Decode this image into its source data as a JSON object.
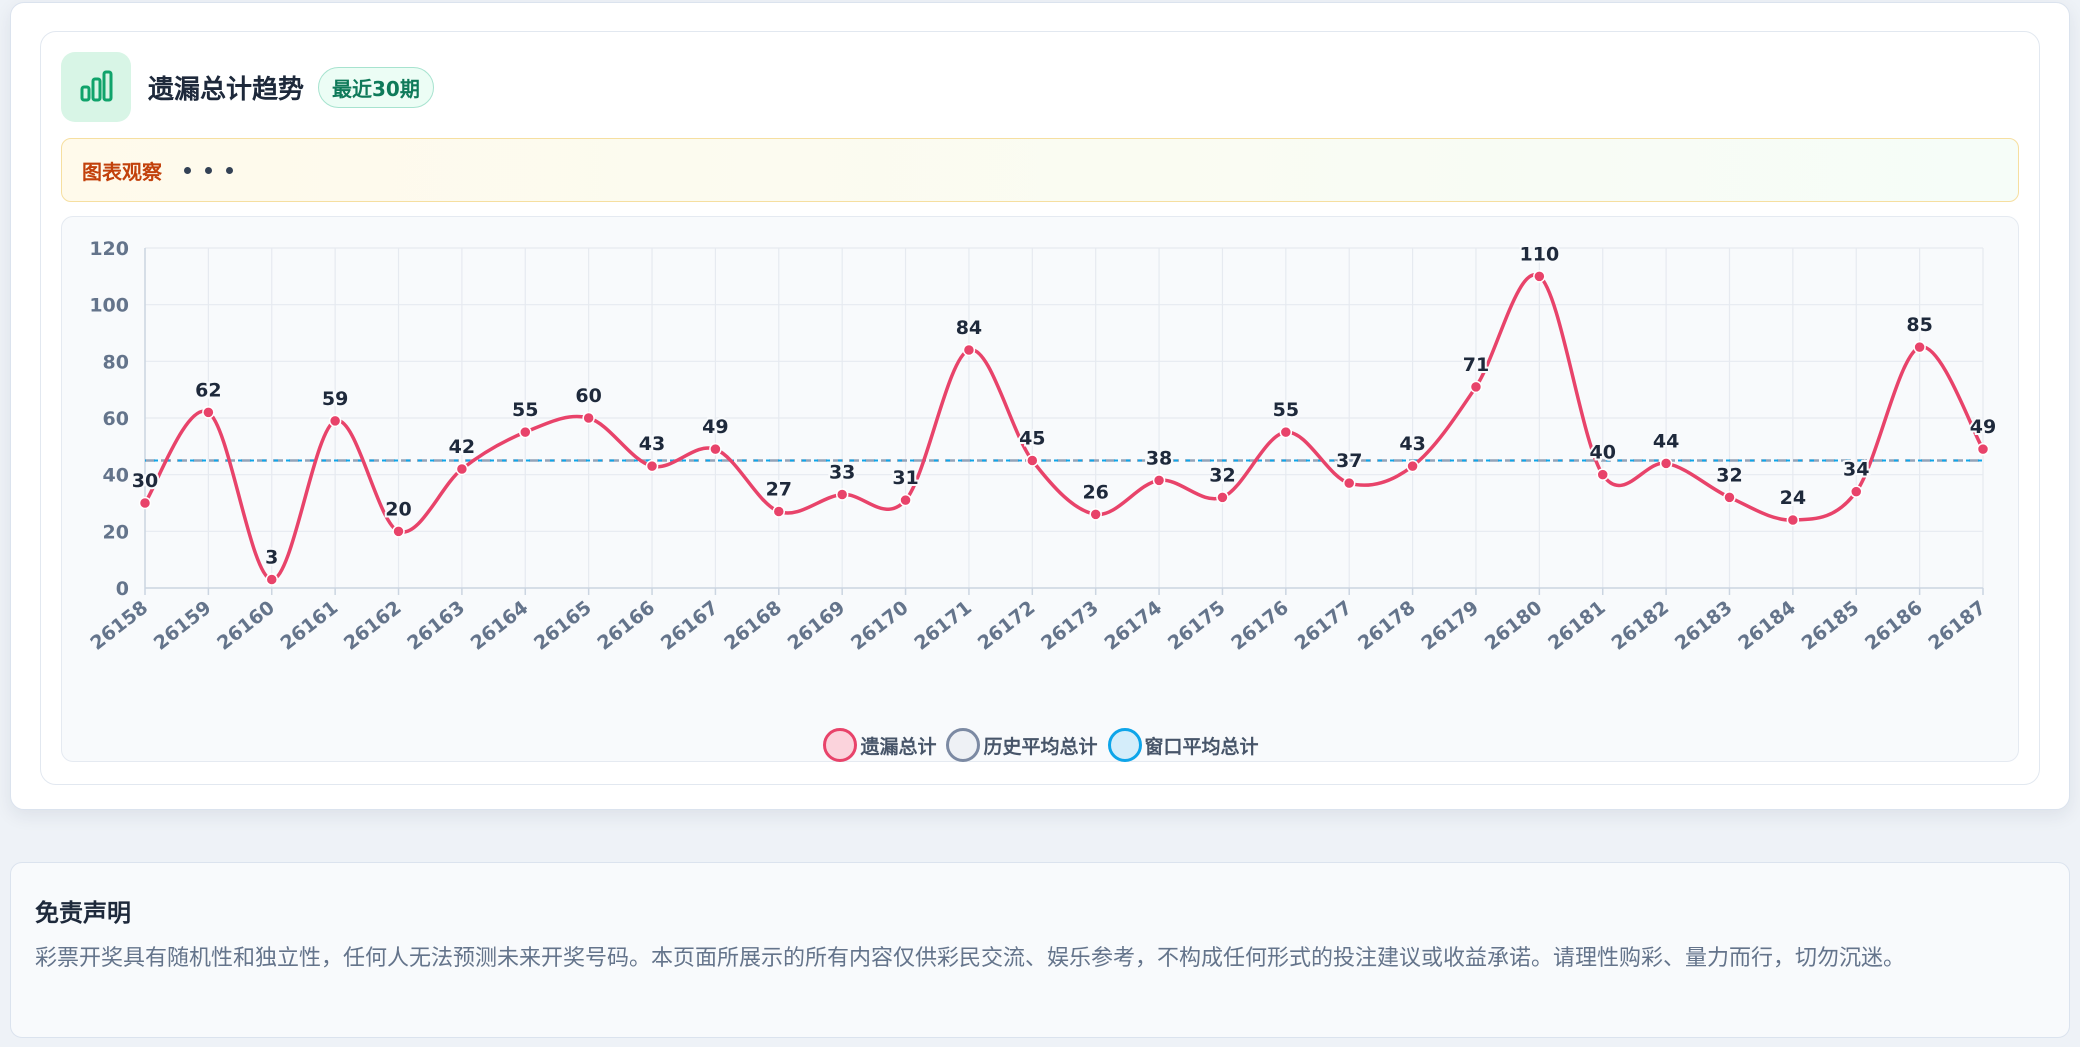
{
  "header": {
    "title": "遗漏总计趋势",
    "badge": "最近30期",
    "icon": "bar-chart-icon"
  },
  "observation": {
    "label": "图表观察"
  },
  "colors": {
    "line": "#e8436a",
    "history_avg": "#94a3b8",
    "window_avg": "#0ea5e9",
    "accent": "#10b981"
  },
  "chart_data": {
    "type": "line",
    "x": [
      "26158",
      "26159",
      "26160",
      "26161",
      "26162",
      "26163",
      "26164",
      "26165",
      "26166",
      "26167",
      "26168",
      "26169",
      "26170",
      "26171",
      "26172",
      "26173",
      "26174",
      "26175",
      "26176",
      "26177",
      "26178",
      "26179",
      "26180",
      "26181",
      "26182",
      "26183",
      "26184",
      "26185",
      "26186",
      "26187"
    ],
    "series": [
      {
        "name": "遗漏总计",
        "values": [
          30,
          62,
          3,
          59,
          20,
          42,
          55,
          60,
          43,
          49,
          27,
          33,
          31,
          84,
          45,
          26,
          38,
          32,
          55,
          37,
          43,
          71,
          110,
          40,
          44,
          32,
          24,
          34,
          85,
          49
        ]
      },
      {
        "name": "历史平均总计",
        "values": [
          45,
          45,
          45,
          45,
          45,
          45,
          45,
          45,
          45,
          45,
          45,
          45,
          45,
          45,
          45,
          45,
          45,
          45,
          45,
          45,
          45,
          45,
          45,
          45,
          45,
          45,
          45,
          45,
          45,
          45
        ]
      },
      {
        "name": "窗口平均总计",
        "values": [
          45,
          45,
          45,
          45,
          45,
          45,
          45,
          45,
          45,
          45,
          45,
          45,
          45,
          45,
          45,
          45,
          45,
          45,
          45,
          45,
          45,
          45,
          45,
          45,
          45,
          45,
          45,
          45,
          45,
          45
        ]
      }
    ],
    "yticks": [
      0,
      20,
      40,
      60,
      80,
      100,
      120
    ],
    "ylim": [
      0,
      120
    ],
    "grid": true,
    "legend": "bottom-center",
    "data_labels": true
  },
  "legend": [
    {
      "label": "遗漏总计"
    },
    {
      "label": "历史平均总计"
    },
    {
      "label": "窗口平均总计"
    }
  ],
  "disclaimer": {
    "title": "免责声明",
    "text": "彩票开奖具有随机性和独立性，任何人无法预测未来开奖号码。本页面所展示的所有内容仅供彩民交流、娱乐参考，不构成任何形式的投注建议或收益承诺。请理性购彩、量力而行，切勿沉迷。"
  }
}
